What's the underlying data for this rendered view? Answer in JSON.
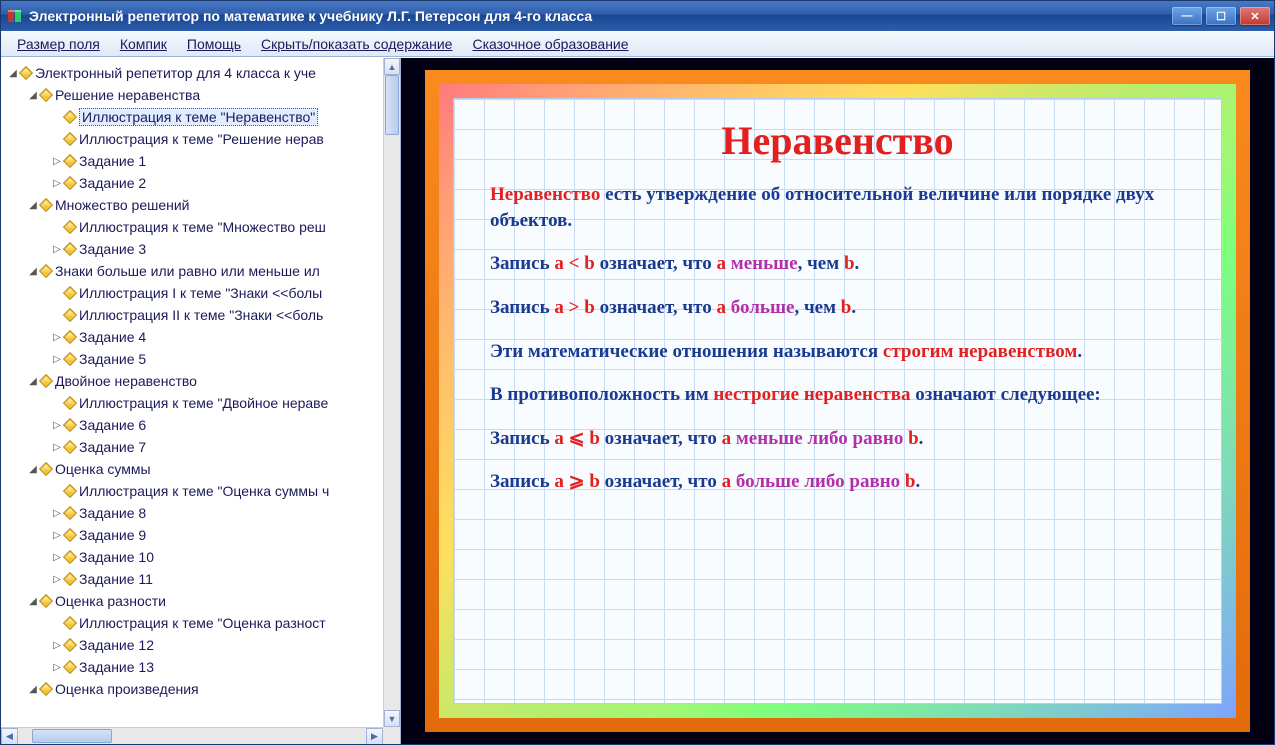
{
  "window": {
    "title": "Электронный репетитор по математике к учебнику Л.Г. Петерсон для 4-го класса"
  },
  "menu": {
    "items": [
      {
        "text": "Размер поля"
      },
      {
        "text": "Компик"
      },
      {
        "text": "Помощь"
      },
      {
        "text": "Скрыть/показать содержание"
      },
      {
        "text": "Сказочное образование"
      }
    ]
  },
  "tree": {
    "root": "Электронный репетитор для 4 класса к уче",
    "sections": [
      {
        "title": "Решение неравенства",
        "children": [
          {
            "label": "Иллюстрация к теме \"Неравенство\"",
            "selected": true,
            "chev": ""
          },
          {
            "label": "Иллюстрация к теме \"Решение нерав",
            "chev": ""
          },
          {
            "label": "Задание 1",
            "chev": "▷"
          },
          {
            "label": "Задание 2",
            "chev": "▷"
          }
        ]
      },
      {
        "title": "Множество решений",
        "children": [
          {
            "label": "Иллюстрация к теме \"Множество реш",
            "chev": ""
          },
          {
            "label": "Задание 3",
            "chev": "▷"
          }
        ]
      },
      {
        "title": "Знаки больше или равно или меньше ил",
        "children": [
          {
            "label": "Иллюстрация I к теме \"Знаки <<болы",
            "chev": ""
          },
          {
            "label": "Иллюстрация II к теме \"Знаки <<боль",
            "chev": ""
          },
          {
            "label": "Задание 4",
            "chev": "▷"
          },
          {
            "label": "Задание 5",
            "chev": "▷"
          }
        ]
      },
      {
        "title": "Двойное неравенство",
        "children": [
          {
            "label": "Иллюстрация к теме \"Двойное нераве",
            "chev": ""
          },
          {
            "label": "Задание 6",
            "chev": "▷"
          },
          {
            "label": "Задание 7",
            "chev": "▷"
          }
        ]
      },
      {
        "title": "Оценка суммы",
        "children": [
          {
            "label": "Иллюстрация к теме \"Оценка суммы ч",
            "chev": ""
          },
          {
            "label": "Задание 8",
            "chev": "▷"
          },
          {
            "label": "Задание 9",
            "chev": "▷"
          },
          {
            "label": "Задание 10",
            "chev": "▷"
          },
          {
            "label": "Задание 11",
            "chev": "▷"
          }
        ]
      },
      {
        "title": "Оценка разности",
        "children": [
          {
            "label": "Иллюстрация к теме \"Оценка разност",
            "chev": ""
          },
          {
            "label": "Задание 12",
            "chev": "▷"
          },
          {
            "label": "Задание 13",
            "chev": "▷"
          }
        ]
      },
      {
        "title": "Оценка произведения",
        "children": []
      }
    ]
  },
  "slide": {
    "title": "Неравенство",
    "p1_lead": "Неравенство",
    "p1_rest": " есть утверждение об относительной ве­личине или порядке двух объектов.",
    "p2_a": "Запись ",
    "p2_rel": "а < b",
    "p2_b": " означает, что ",
    "p2_v1": "a",
    "p2_c": " ",
    "p2_word": "меньше",
    "p2_d": ", чем ",
    "p2_v2": "b",
    "p2_e": ".",
    "p3_a": "Запись ",
    "p3_rel": "а > b",
    "p3_b": " означает, что ",
    "p3_v1": "a",
    "p3_c": " ",
    "p3_word": "больше",
    "p3_d": ", чем ",
    "p3_v2": "b",
    "p3_e": ".",
    "p4_a": "Эти математические отношения называются ",
    "p4_red": "строгим неравенством",
    "p4_b": ".",
    "p5_a": "В противоположность им ",
    "p5_red": "нестрогие неравенства",
    "p5_b": " оз­начают следующее:",
    "p6_a": "Запись ",
    "p6_rel": "а ⩽ b",
    "p6_b": " означает, что ",
    "p6_v1": "a",
    "p6_c": " ",
    "p6_word": "меньше либо равно",
    "p6_d": " ",
    "p6_v2": "b",
    "p6_e": ".",
    "p7_a": "Запись ",
    "p7_rel": "а ⩾ b",
    "p7_b": " означает, что ",
    "p7_v1": "a",
    "p7_c": " ",
    "p7_word": "больше либо равно",
    "p7_d": " ",
    "p7_v2": "b",
    "p7_e": "."
  },
  "chev": {
    "open": "◢",
    "closed": "▷"
  }
}
